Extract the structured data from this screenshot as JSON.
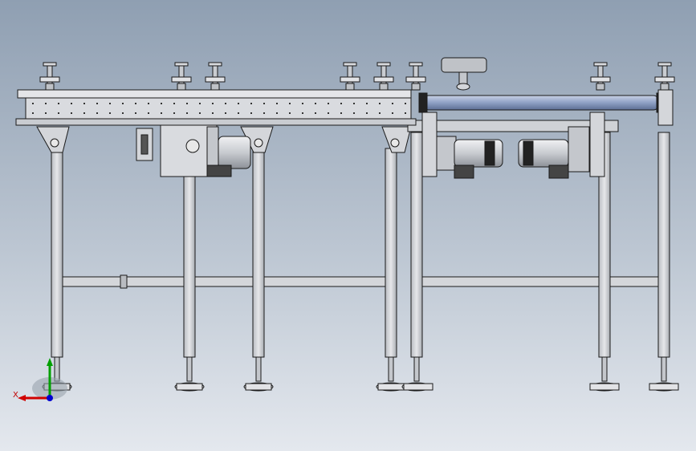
{
  "viewport": {
    "background_top": "#8f9fb2",
    "background_bottom": "#e4e8ee"
  },
  "model": {
    "components": [
      "conveyor-frame",
      "side-rail",
      "support-legs",
      "cross-braces",
      "leveling-feet",
      "guide-handles",
      "drive-motor",
      "transfer-roller",
      "transfer-motors",
      "handwheel"
    ],
    "colors": {
      "frame_fill": "#d9dbdf",
      "outline": "#1a1a1a",
      "roller": "#8ea0c4",
      "motor": "#c8cbd0"
    }
  },
  "triad": {
    "x_label": "X",
    "x_color": "#d00000",
    "y_color": "#00a000",
    "z_color": "#0000d0"
  }
}
